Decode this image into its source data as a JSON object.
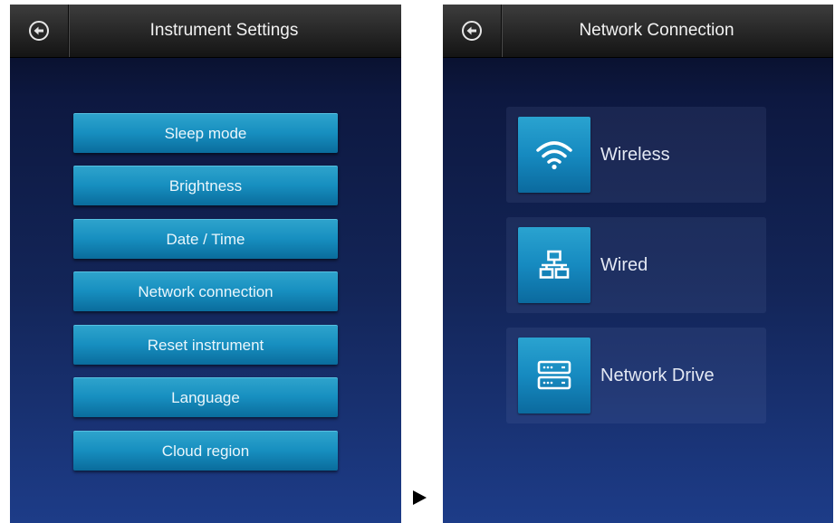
{
  "left_screen": {
    "title": "Instrument Settings",
    "back_icon": "back-arrow-circle-icon",
    "menu": [
      {
        "label": "Sleep mode"
      },
      {
        "label": "Brightness"
      },
      {
        "label": "Date / Time"
      },
      {
        "label": "Network connection"
      },
      {
        "label": "Reset instrument"
      },
      {
        "label": "Language"
      },
      {
        "label": "Cloud region"
      }
    ]
  },
  "transition_icon": "right-triangle-arrow-icon",
  "right_screen": {
    "title": "Network Connection",
    "back_icon": "back-arrow-circle-icon",
    "options": [
      {
        "label": "Wireless",
        "icon": "wifi-icon"
      },
      {
        "label": "Wired",
        "icon": "wired-network-icon"
      },
      {
        "label": "Network Drive",
        "icon": "network-drive-icon"
      }
    ]
  },
  "colors": {
    "accent_button": "#178fc0",
    "header": "#262626",
    "background_top": "#060a1c",
    "background_bottom": "#1d3c88"
  }
}
